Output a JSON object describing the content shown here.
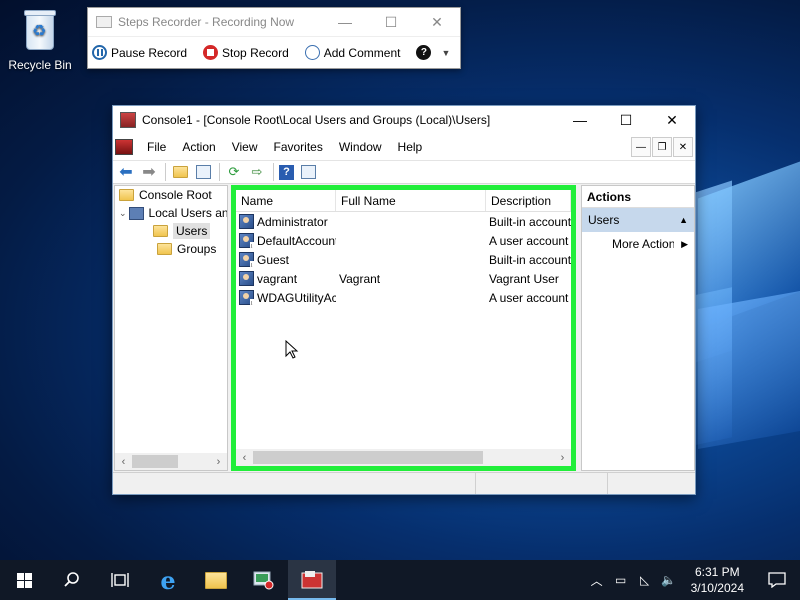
{
  "desktop": {
    "recycle_bin_label": "Recycle Bin"
  },
  "steps_recorder": {
    "title": "Steps Recorder - Recording Now",
    "pause_label": "Pause Record",
    "stop_label": "Stop Record",
    "comment_label": "Add Comment"
  },
  "mmc": {
    "title": "Console1 - [Console Root\\Local Users and Groups (Local)\\Users]",
    "menu": [
      "File",
      "Action",
      "View",
      "Favorites",
      "Window",
      "Help"
    ],
    "tree": {
      "root": "Console Root",
      "local": "Local Users and Groups (Local)",
      "users": "Users",
      "groups": "Groups"
    },
    "list": {
      "columns": [
        "Name",
        "Full Name",
        "Description"
      ],
      "rows": [
        {
          "name": "Administrator",
          "full_name": "",
          "description": "Built-in account for administering"
        },
        {
          "name": "DefaultAccount",
          "full_name": "",
          "description": "A user account managed by the system"
        },
        {
          "name": "Guest",
          "full_name": "",
          "description": "Built-in account for guest access"
        },
        {
          "name": "vagrant",
          "full_name": "Vagrant",
          "description": "Vagrant User"
        },
        {
          "name": "WDAGUtilityAccount",
          "full_name": "",
          "description": "A user account managed and used by"
        }
      ]
    },
    "actions": {
      "header": "Actions",
      "section": "Users",
      "more": "More Actions"
    }
  },
  "taskbar": {
    "time": "6:31 PM",
    "date": "3/10/2024"
  },
  "colors": {
    "highlight_border": "#21ee3a",
    "actions_section_bg": "#c6d8ec"
  }
}
